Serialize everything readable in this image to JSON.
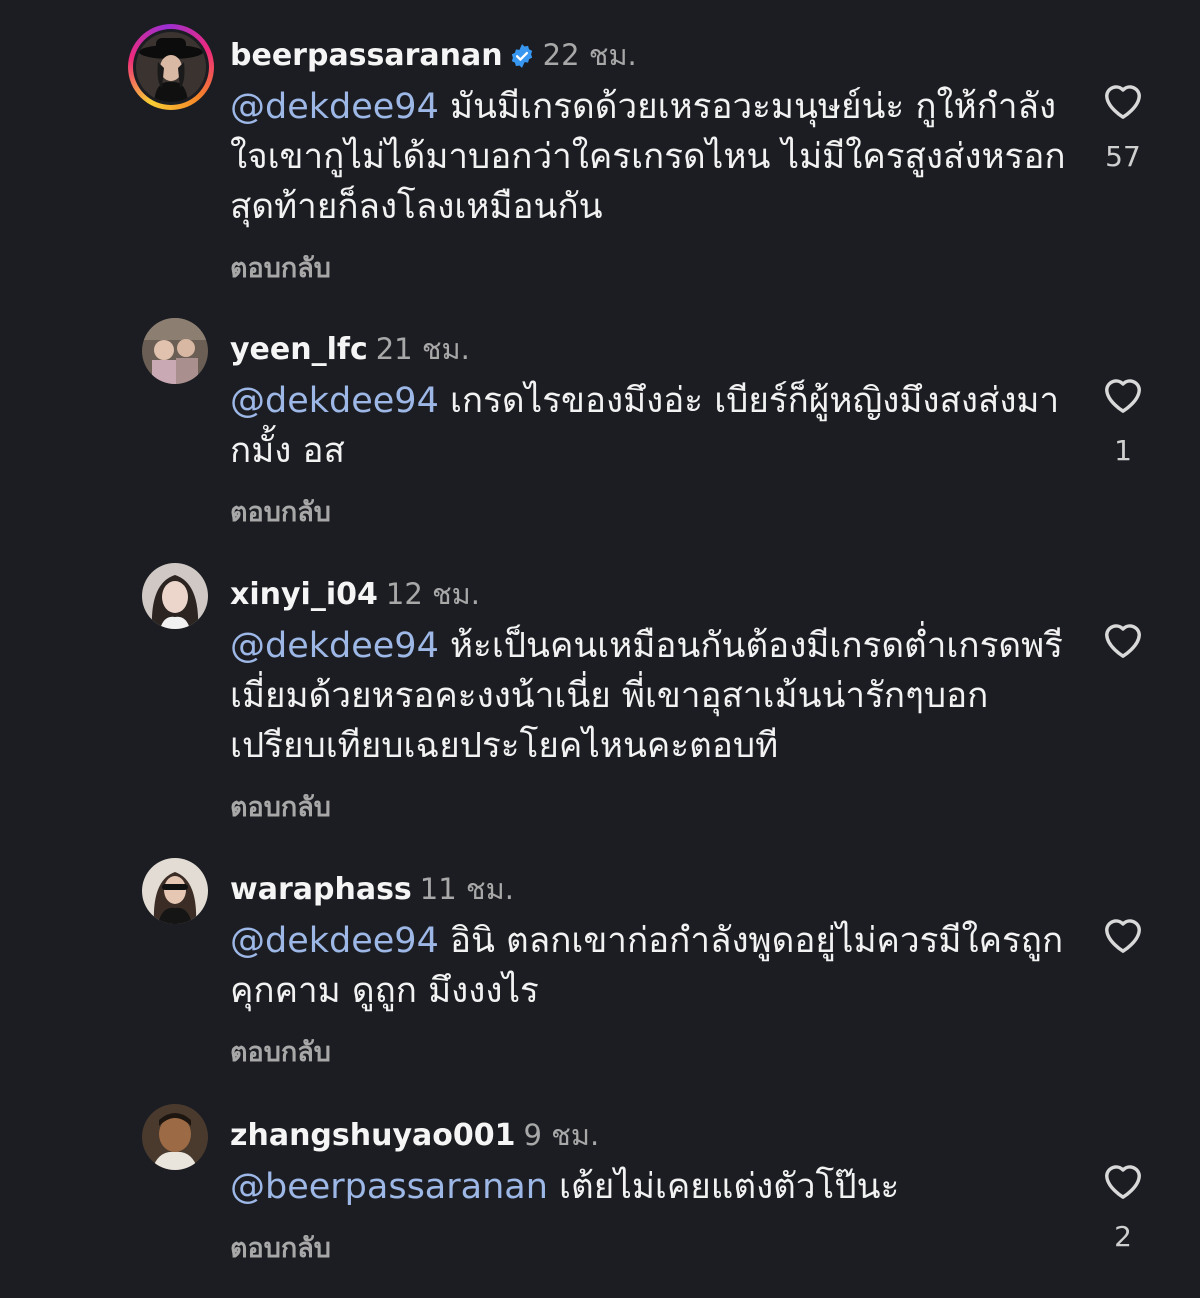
{
  "comments": [
    {
      "username": "beerpassaranan",
      "verified": true,
      "time": "22 ชม.",
      "mention": "@dekdee94",
      "text": " มันมีเกรดด้วยเหรอวะมนุษย์น่ะ กูให้กำลังใจเขากูไม่ได้มาบอกว่าใครเกรดไหน ไม่มีใครสูงส่งหรอกสุดท้ายก็ลงโลงเหมือนกัน",
      "reply": "ตอบกลับ",
      "likes": "57",
      "avatar_icon": "profile-photo-story-ring"
    },
    {
      "username": "yeen_lfc",
      "time": "21 ชม.",
      "mention": "@dekdee94",
      "text": " เกรดไรของมึงอ่ะ เบียร์ก็ผู้หญิงมึงสงส่งมากมั้ง อส",
      "reply": "ตอบกลับ",
      "likes": "1",
      "avatar_icon": "profile-photo"
    },
    {
      "username": "xinyi_i04",
      "time": "12 ชม.",
      "mention": "@dekdee94",
      "text": " ห้ะเป็นคนเหมือนกันต้องมีเกรดต่ำเกรดพรีเมี่ยมด้วยหรอคะงงน้าเนี่ย พี่เขาอุสาเม้นน่ารักๆบอกเปรียบเทียบเฉยประโยคไหนคะตอบที",
      "reply": "ตอบกลับ",
      "likes": "",
      "avatar_icon": "profile-photo"
    },
    {
      "username": "waraphass",
      "time": "11 ชม.",
      "mention": "@dekdee94",
      "text": " อินิ ตลกเขาก่อกำลังพูดอยู่ไม่ควรมีใครถูกคุกคาม ดูถูก มึงงงไร",
      "reply": "ตอบกลับ",
      "likes": "",
      "avatar_icon": "profile-photo"
    },
    {
      "username": "zhangshuyao001",
      "time": "9 ชม.",
      "mention": "@beerpassaranan",
      "text": " เต้ยไม่เคยแต่งตัวโป๊นะ",
      "reply": "ตอบกลับ",
      "likes": "2",
      "avatar_icon": "profile-photo"
    }
  ],
  "colors": {
    "background": "#1b1d22",
    "mention": "#9db7e6",
    "secondary_text": "#a8a8a8",
    "verified_badge": "#3897f0"
  }
}
